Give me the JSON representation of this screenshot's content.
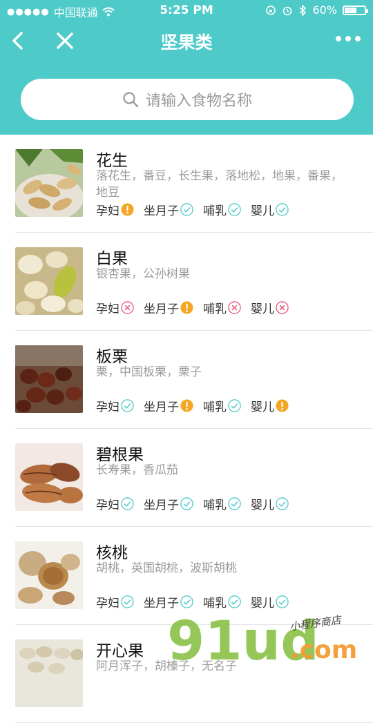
{
  "status_bar": {
    "signal": "●●●●●",
    "carrier": "中国联通",
    "time": "5:25 PM",
    "battery": "60%",
    "battery_level": 0.6
  },
  "nav": {
    "title": "坚果类",
    "icons": [
      "back-icon",
      "close-icon",
      "more-icon"
    ]
  },
  "search": {
    "placeholder": "请输入食物名称"
  },
  "labels": {
    "pregnant": "孕妇",
    "postpartum": "坐月子",
    "nursing": "哺乳",
    "infant": "婴儿"
  },
  "colors": {
    "brand": "#4ecac9",
    "ok": "#4ecac9",
    "caution": "#f5a623",
    "avoid": "#e8567a"
  },
  "foods": [
    {
      "name": "花生",
      "alias": "落花生，番豆，长生果，落地松，地果，番果，地豆",
      "status": [
        "caution",
        "ok",
        "ok",
        "ok"
      ]
    },
    {
      "name": "白果",
      "alias": "银杏果，公孙树果",
      "status": [
        "avoid",
        "caution",
        "avoid",
        "avoid"
      ]
    },
    {
      "name": "板栗",
      "alias": "栗，中国板栗，栗子",
      "status": [
        "ok",
        "caution",
        "ok",
        "caution"
      ]
    },
    {
      "name": "碧根果",
      "alias": "长寿果，香瓜茄",
      "status": [
        "ok",
        "ok",
        "ok",
        "ok"
      ]
    },
    {
      "name": "核桃",
      "alias": "胡桃，英国胡桃，波斯胡桃",
      "status": [
        "ok",
        "ok",
        "ok",
        "ok"
      ]
    },
    {
      "name": "开心果",
      "alias": "阿月浑子，胡榛子，无名子",
      "status": []
    }
  ],
  "watermark": {
    "text": "91ud",
    "suffix": ".com",
    "tagline": "小程序商店"
  }
}
